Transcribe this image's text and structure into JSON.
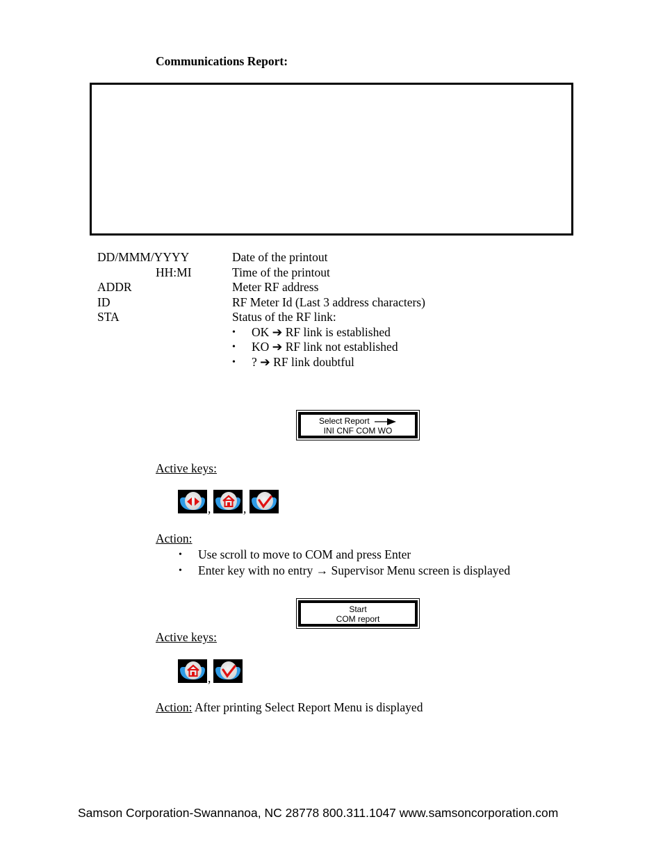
{
  "section_title": "Communications Report:",
  "definitions": [
    {
      "term": "DD/MMM/YYYY",
      "desc": "Date of the printout"
    },
    {
      "term": "HH:MI",
      "desc": "Time of the printout"
    },
    {
      "term": "ADDR",
      "desc": "Meter RF address"
    },
    {
      "term": "ID",
      "desc": "RF Meter Id (Last 3 address characters)"
    },
    {
      "term": "STA",
      "desc": "Status of the RF link:"
    }
  ],
  "status_bullets": [
    {
      "text": "OK ➔ RF link is established"
    },
    {
      "text": "KO ➔ RF link not established"
    },
    {
      "text": "? ➔ RF link doubtful"
    }
  ],
  "screen1": {
    "line1": "Select Report",
    "line2": "INI CNF COM WO",
    "arrow_icon": "right-arrow-icon"
  },
  "step1": {
    "active_keys_label": "Active keys:",
    "keys": [
      "scroll-key-icon",
      "home-key-icon",
      "enter-key-icon"
    ],
    "comma": ",",
    "action_label": "Action:",
    "actions": [
      "Use scroll to move to COM and press Enter",
      "Enter key with no entry → Supervisor Menu screen is displayed"
    ]
  },
  "screen2": {
    "line1": "Start",
    "line2": "COM report"
  },
  "step2": {
    "active_keys_label": "Active keys:",
    "keys": [
      "home-key-icon",
      "enter-key-icon"
    ],
    "comma": ",",
    "action_label": "Action:",
    "action_text": " After printing Select Report Menu is displayed"
  },
  "footer": "Samson Corporation-Swannanoa, NC 28778  800.311.1047 www.samsoncorporation.com",
  "bullet_char": "•"
}
